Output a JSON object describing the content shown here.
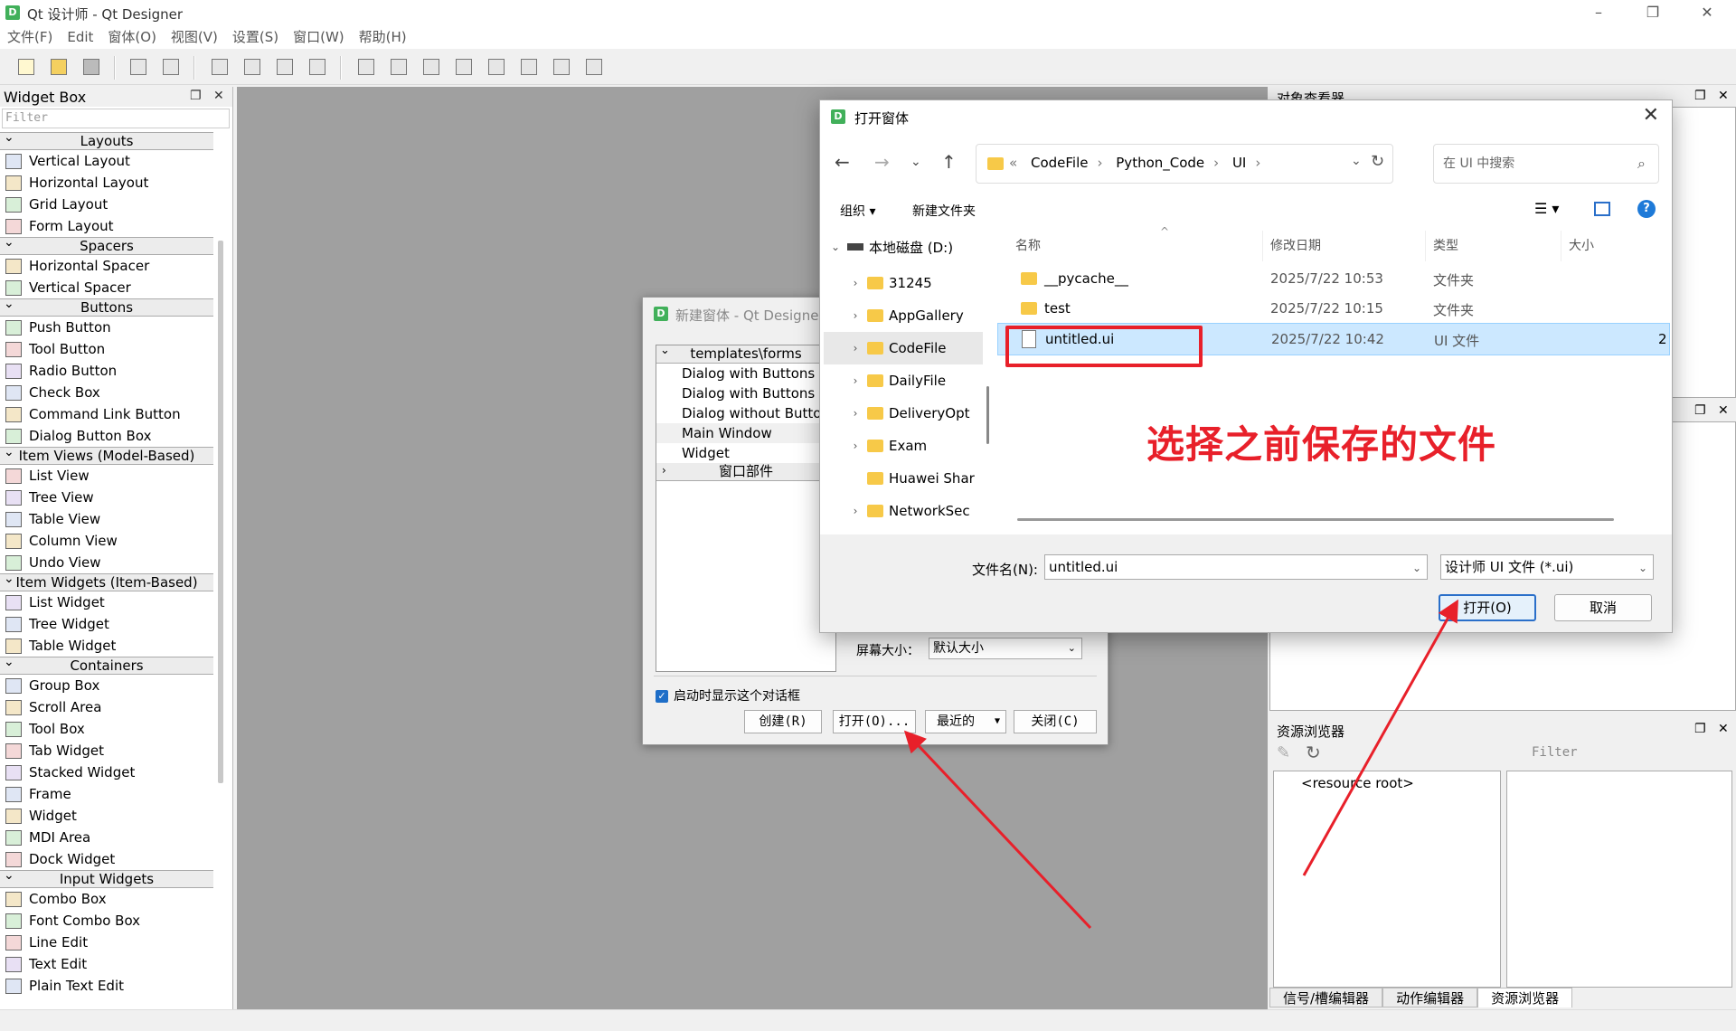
{
  "app": {
    "title": "Qt 设计师 - Qt Designer",
    "icon_letter": "D"
  },
  "window_controls": {
    "minimize": "–",
    "maximize": "❐",
    "close": "✕"
  },
  "menubar": [
    "文件(F)",
    "Edit",
    "窗体(O)",
    "视图(V)",
    "设置(S)",
    "窗口(W)",
    "帮助(H)"
  ],
  "widget_box": {
    "title": "Widget Box",
    "filter_placeholder": "Filter",
    "categories": [
      {
        "name": "Layouts",
        "items": [
          "Vertical Layout",
          "Horizontal Layout",
          "Grid Layout",
          "Form Layout"
        ]
      },
      {
        "name": "Spacers",
        "items": [
          "Horizontal Spacer",
          "Vertical Spacer"
        ]
      },
      {
        "name": "Buttons",
        "items": [
          "Push Button",
          "Tool Button",
          "Radio Button",
          "Check Box",
          "Command Link Button",
          "Dialog Button Box"
        ]
      },
      {
        "name": "Item Views (Model-Based)",
        "items": [
          "List View",
          "Tree View",
          "Table View",
          "Column View",
          "Undo View"
        ]
      },
      {
        "name": "Item Widgets (Item-Based)",
        "items": [
          "List Widget",
          "Tree Widget",
          "Table Widget"
        ]
      },
      {
        "name": "Containers",
        "items": [
          "Group Box",
          "Scroll Area",
          "Tool Box",
          "Tab Widget",
          "Stacked Widget",
          "Frame",
          "Widget",
          "MDI Area",
          "Dock Widget"
        ]
      },
      {
        "name": "Input Widgets",
        "items": [
          "Combo Box",
          "Font Combo Box",
          "Line Edit",
          "Text Edit",
          "Plain Text Edit"
        ]
      }
    ]
  },
  "right_panels": {
    "object_inspector": "对象查看器",
    "resource_browser": "资源浏览器",
    "resource_filter_placeholder": "Filter",
    "resource_root": "<resource root>",
    "bottom_tabs": [
      "信号/槽编辑器",
      "动作编辑器",
      "资源浏览器"
    ]
  },
  "new_form_dialog": {
    "title": "新建窗体 - Qt Designer",
    "templates_header": "templates\\forms",
    "templates": [
      "Dialog with Buttons ...",
      "Dialog with Buttons ...",
      "Dialog without Buttons",
      "Main Window",
      "Widget"
    ],
    "selected_template": "Main Window",
    "widgets_header": "窗口部件",
    "screen_size_label": "屏幕大小：",
    "screen_size_value": "默认大小",
    "show_on_startup": "启动时显示这个对话框",
    "buttons": {
      "create": "创建(R)",
      "open": "打开(O)...",
      "recent": "最近的",
      "close": "关闭(C)"
    }
  },
  "open_dialog": {
    "title": "打开窗体",
    "path": [
      "CodeFile",
      "Python_Code",
      "UI"
    ],
    "search_placeholder": "在 UI 中搜索",
    "organize": "组织 ▾",
    "new_folder": "新建文件夹",
    "nav": {
      "drive": "本地磁盘 (D:)",
      "folders": [
        "31245",
        "AppGallery",
        "CodeFile",
        "DailyFile",
        "DeliveryOpt",
        "Exam",
        "Huawei Shar",
        "NetworkSec"
      ],
      "selected": "CodeFile"
    },
    "columns": {
      "name": "名称",
      "modified": "修改日期",
      "type": "类型",
      "size": "大小"
    },
    "files": [
      {
        "name": "__pycache__",
        "date": "2025/7/22 10:53",
        "type": "文件夹",
        "size": ""
      },
      {
        "name": "test",
        "date": "2025/7/22 10:15",
        "type": "文件夹",
        "size": ""
      },
      {
        "name": "untitled.ui",
        "date": "2025/7/22 10:42",
        "type": "UI 文件",
        "size": "2"
      }
    ],
    "filename_label": "文件名(N):",
    "filename_value": "untitled.ui",
    "filetype_value": "设计师 UI 文件 (*.ui)",
    "open_button": "打开(O)",
    "cancel_button": "取消"
  },
  "annotation": {
    "text": "选择之前保存的文件",
    "color": "#e8202a"
  }
}
